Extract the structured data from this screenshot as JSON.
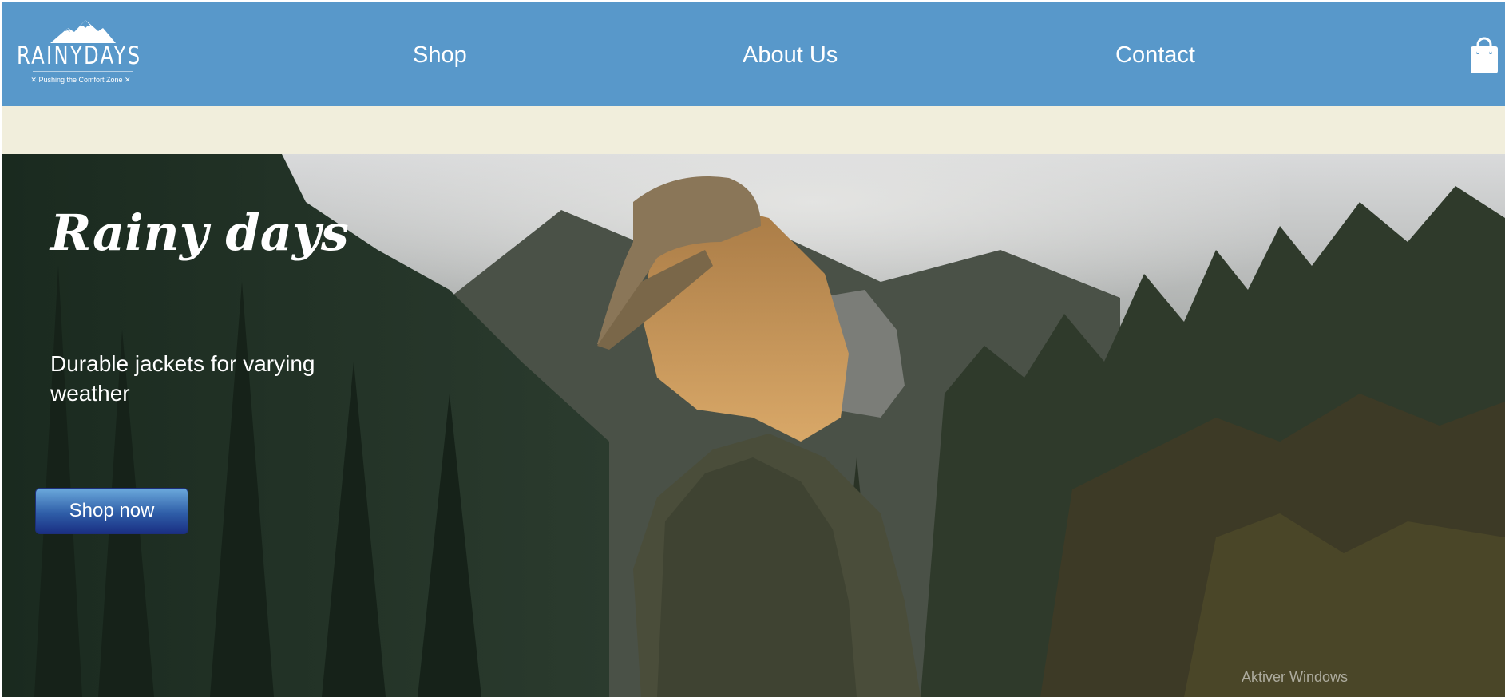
{
  "logo": {
    "wordmark": "RAINYDAYS",
    "tagline": "✕ Pushing the Comfort Zone ✕"
  },
  "nav": {
    "items": [
      {
        "label": "Shop"
      },
      {
        "label": "About Us"
      },
      {
        "label": "Contact"
      }
    ],
    "cart_icon": "shopping-bag-icon"
  },
  "hero": {
    "title": "Rainy days",
    "subtitle": "Durable jackets for varying weather",
    "cta_label": "Shop now",
    "image": "woman in olive rain jacket and cap overlooking misty forested mountains"
  },
  "overlay": {
    "watermark": "Aktiver Windows"
  },
  "colors": {
    "navbar": "#5898ca",
    "page_background": "#f1eedc",
    "cta_top": "#6ba9dc",
    "cta_bottom": "#1a2f83",
    "text": "#ffffff"
  }
}
